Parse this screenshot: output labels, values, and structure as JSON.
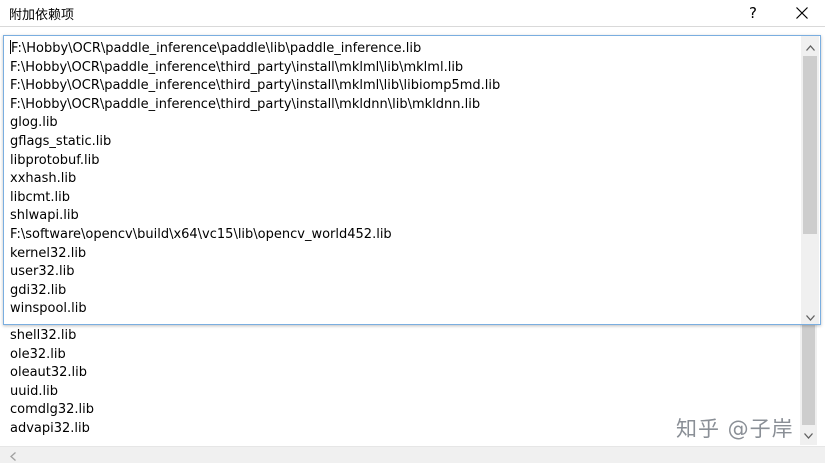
{
  "dialog": {
    "title": "附加依赖项",
    "help_label": "?",
    "close_icon": "close-icon"
  },
  "inner_list": {
    "items": [
      "F:\\Hobby\\OCR\\paddle_inference\\paddle\\lib\\paddle_inference.lib",
      "F:\\Hobby\\OCR\\paddle_inference\\third_party\\install\\mklml\\lib\\mklml.lib",
      "F:\\Hobby\\OCR\\paddle_inference\\third_party\\install\\mklml\\lib\\libiomp5md.lib",
      "F:\\Hobby\\OCR\\paddle_inference\\third_party\\install\\mkldnn\\lib\\mkldnn.lib",
      "glog.lib",
      "gflags_static.lib",
      "libprotobuf.lib",
      "xxhash.lib",
      "libcmt.lib",
      "shlwapi.lib",
      "F:\\software\\opencv\\build\\x64\\vc15\\lib\\opencv_world452.lib",
      "kernel32.lib",
      "user32.lib",
      "gdi32.lib",
      "winspool.lib"
    ],
    "scroll_up_icon": "chevron-up-icon",
    "scroll_down_icon": "chevron-down-icon"
  },
  "outer_list": {
    "items": [
      "shell32.lib",
      "ole32.lib",
      "oleaut32.lib",
      "uuid.lib",
      "comdlg32.lib",
      "advapi32.lib"
    ]
  },
  "watermark": "知乎 @子岸"
}
